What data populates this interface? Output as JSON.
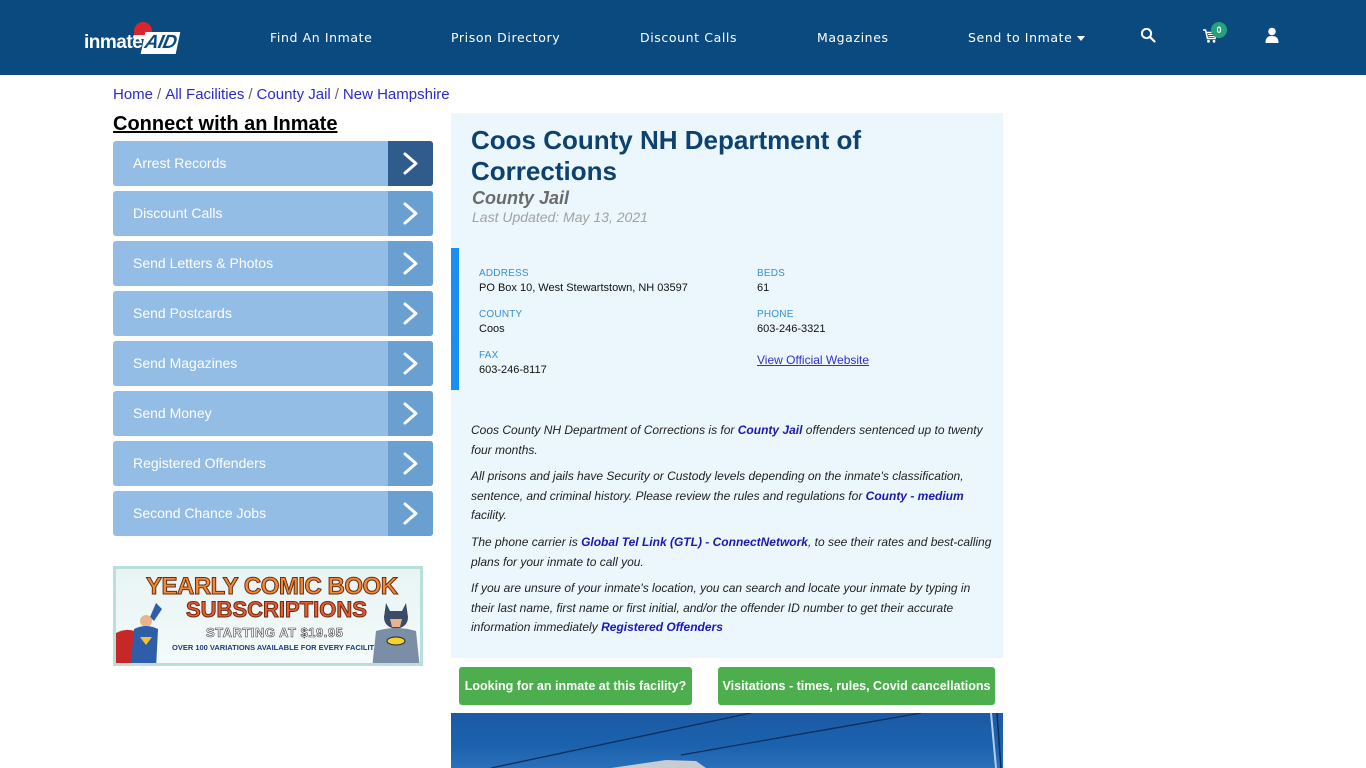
{
  "header": {
    "logo": {
      "main": "inmate",
      "accent": "AID"
    },
    "nav": [
      {
        "label": "Find An Inmate"
      },
      {
        "label": "Prison Directory"
      },
      {
        "label": "Discount Calls"
      },
      {
        "label": "Magazines"
      },
      {
        "label": "Send to Inmate",
        "dropdown": true
      }
    ],
    "icons": [
      "search-icon",
      "cart-icon",
      "user-icon"
    ],
    "cart_count": "0"
  },
  "breadcrumb": {
    "items": [
      "Home",
      "All Facilities",
      "County Jail",
      "New Hampshire"
    ],
    "separator": "/"
  },
  "sidebar": {
    "title": "Connect with an Inmate",
    "items": [
      {
        "label": "Arrest Records",
        "active": true
      },
      {
        "label": "Discount Calls"
      },
      {
        "label": "Send Letters & Photos"
      },
      {
        "label": "Send Postcards"
      },
      {
        "label": "Send Magazines"
      },
      {
        "label": "Send Money"
      },
      {
        "label": "Registered Offenders"
      },
      {
        "label": "Second Chance Jobs"
      }
    ],
    "ad": {
      "line1": "YEARLY COMIC BOOK",
      "line2": "SUBSCRIPTIONS",
      "line3": "STARTING AT $19.95",
      "line4": "OVER 100 VARIATIONS AVAILABLE FOR EVERY FACILITY"
    }
  },
  "facility": {
    "name": "Coos County NH Department of Corrections",
    "type": "County Jail",
    "last_updated": "Last Updated: May 13, 2021",
    "info": {
      "address_label": "ADDRESS",
      "address": "PO Box 10, West Stewartstown, NH 03597",
      "beds_label": "BEDS",
      "beds": "61",
      "county_label": "COUNTY",
      "county": "Coos",
      "phone_label": "PHONE",
      "phone": "603-246-3321",
      "fax_label": "FAX",
      "fax": "603-246-8117",
      "website_link": "View Official Website"
    },
    "paragraphs": {
      "p1_a": "Coos County NH Department of Corrections is for ",
      "p1_link": "County Jail",
      "p1_b": " offenders sentenced up to twenty four months.",
      "p2_a": "All prisons and jails have Security or Custody levels depending on the inmate's classification, sentence, and criminal history. Please review the rules and regulations for ",
      "p2_link": "County - medium",
      "p2_b": " facility.",
      "p3_a": "The phone carrier is ",
      "p3_link": "Global Tel Link (GTL) - ConnectNetwork",
      "p3_b": ", to see their rates and best-calling plans for your inmate to call you.",
      "p4_a": "If you are unsure of your inmate's location, you can search and locate your inmate by typing in their last name, first name or first initial, and/or the offender ID number to get their accurate information immediately ",
      "p4_link": "Registered Offenders"
    },
    "buttons": {
      "find_inmate": "Looking for an inmate at this facility?",
      "visitations": "Visitations - times, rules, Covid cancellations"
    }
  },
  "colors": {
    "header_bg": "#0b4a7f",
    "sidebar_item": "#94bde6",
    "sidebar_arrow": "#6a9fd2",
    "sidebar_arrow_active": "#2f5c8a",
    "card_bg": "#ebf6fd",
    "accent_bar": "#1a8ef2",
    "title": "#0d4170",
    "green_button": "#4cae4c",
    "cart_badge": "#25a27a"
  }
}
